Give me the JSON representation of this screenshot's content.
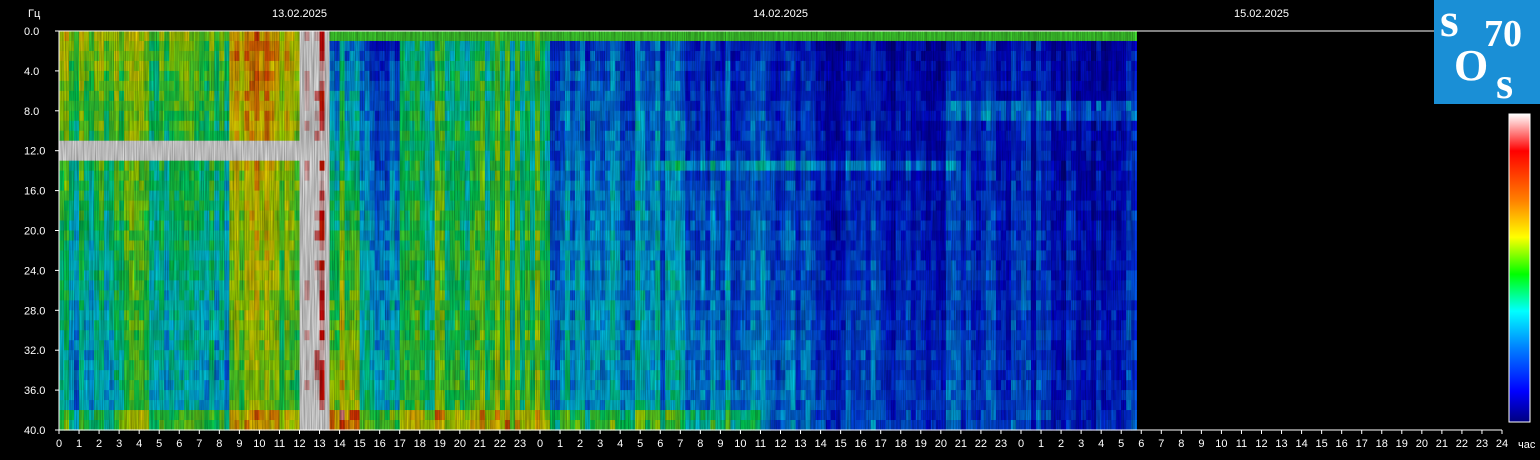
{
  "chart_data": {
    "type": "heatmap",
    "title": "",
    "ylabel": "Гц",
    "xlabel": "час",
    "ylim": [
      0,
      40
    ],
    "ytick_labels": [
      "0.0",
      "4.0",
      "8.0",
      "12.0",
      "16.0",
      "20.0",
      "24.0",
      "28.0",
      "32.0",
      "36.0",
      "40.0"
    ],
    "ytick_values": [
      0,
      4,
      8,
      12,
      16,
      20,
      24,
      28,
      32,
      36,
      40
    ],
    "dates": [
      {
        "label": "13.02.2025",
        "hour_offset": 12
      },
      {
        "label": "14.02.2025",
        "hour_offset": 36
      },
      {
        "label": "15.02.2025",
        "hour_offset": 60
      }
    ],
    "xtick_labels": [
      "0",
      "1",
      "2",
      "3",
      "4",
      "5",
      "6",
      "7",
      "8",
      "9",
      "10",
      "11",
      "12",
      "13",
      "14",
      "15",
      "16",
      "17",
      "18",
      "19",
      "20",
      "21",
      "22",
      "23",
      "0",
      "1",
      "2",
      "3",
      "4",
      "5",
      "6",
      "7",
      "8",
      "9",
      "10",
      "11",
      "12",
      "13",
      "14",
      "15",
      "16",
      "17",
      "18",
      "19",
      "20",
      "21",
      "22",
      "23",
      "0",
      "1",
      "2",
      "3",
      "4",
      "5",
      "6",
      "7",
      "8",
      "9",
      "10",
      "11",
      "12",
      "13",
      "14",
      "15",
      "16",
      "17",
      "18",
      "19",
      "20",
      "21",
      "22",
      "23",
      "24"
    ],
    "xlim_hours": [
      0,
      72
    ],
    "data_end_hour": 53.7,
    "colorbar": [
      "#ffffff",
      "#ff0000",
      "#ff8000",
      "#ffff00",
      "#00ff00",
      "#00ffff",
      "#0080ff",
      "#0000ff",
      "#000080"
    ],
    "intensity_segments": [
      {
        "start": 0,
        "end": 3,
        "low": 0.35,
        "high": 0.65
      },
      {
        "start": 3,
        "end": 5,
        "low": 0.45,
        "high": 0.6
      },
      {
        "start": 5,
        "end": 8.5,
        "low": 0.35,
        "high": 0.6
      },
      {
        "start": 8.5,
        "end": 12,
        "low": 0.55,
        "high": 0.75
      },
      {
        "start": 12,
        "end": 13.5,
        "low": 1.0,
        "high": 1.0
      },
      {
        "start": 13.5,
        "end": 15,
        "low": 0.7,
        "high": 0.3
      },
      {
        "start": 15,
        "end": 17,
        "low": 0.45,
        "high": 0.2
      },
      {
        "start": 17,
        "end": 24.5,
        "low": 0.55,
        "high": 0.45
      },
      {
        "start": 24.5,
        "end": 30,
        "low": 0.4,
        "high": 0.25
      },
      {
        "start": 30,
        "end": 34,
        "low": 0.35,
        "high": 0.2
      },
      {
        "start": 34,
        "end": 38,
        "low": 0.3,
        "high": 0.17
      },
      {
        "start": 38,
        "end": 45,
        "low": 0.25,
        "high": 0.12
      },
      {
        "start": 45,
        "end": 53.7,
        "low": 0.2,
        "high": 0.12
      }
    ]
  },
  "logo": {
    "letter_s1": "s",
    "letter_o": "O",
    "letter_s2": "s",
    "number": "70"
  },
  "colors": {
    "background": "#000000",
    "axis": "#ffffff",
    "logo_bg": "#1a8fd6"
  }
}
